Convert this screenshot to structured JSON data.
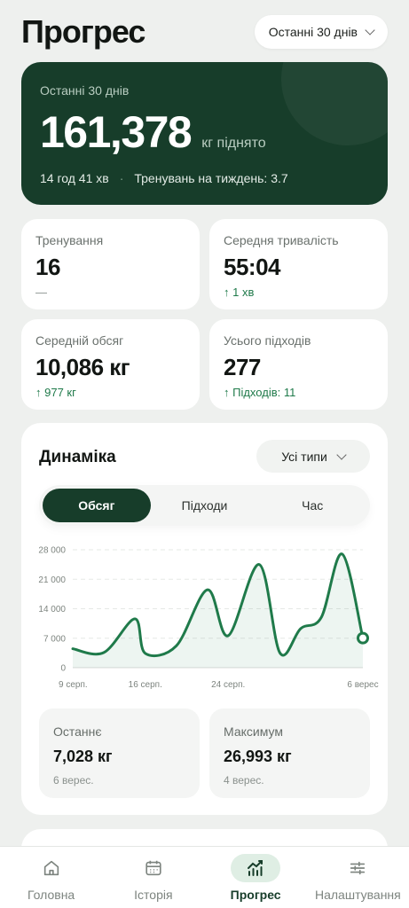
{
  "header": {
    "title": "Прогрес",
    "range": "Останні 30 днів"
  },
  "hero": {
    "period": "Останні 30 днів",
    "total": "161,378",
    "unit": "кг піднято",
    "duration": "14 год 41 хв",
    "weekly": "Тренувань на тиждень: 3.7"
  },
  "stats": [
    {
      "label": "Тренування",
      "value": "16",
      "delta": "—"
    },
    {
      "label": "Середня тривалість",
      "value": "55:04",
      "delta": "↑ 1 хв"
    },
    {
      "label": "Середній обсяг",
      "value": "10,086 кг",
      "delta": "↑ 977 кг"
    },
    {
      "label": "Усього підходів",
      "value": "277",
      "delta": "↑ Підходів: 11"
    }
  ],
  "dynamics": {
    "title": "Динаміка",
    "type_filter": "Усі типи",
    "segments": [
      "Обсяг",
      "Підходи",
      "Час"
    ],
    "last": {
      "label": "Останнє",
      "value": "7,028 кг",
      "date": "6 верес."
    },
    "max": {
      "label": "Максимум",
      "value": "26,993 кг",
      "date": "4 верес."
    }
  },
  "chart_data": {
    "type": "line",
    "x_ticks": [
      "9 серп.",
      "16 серп.",
      "24 серп.",
      "6 верес"
    ],
    "y_ticks": [
      "0",
      "7 000",
      "14 000",
      "21 000",
      "28 000"
    ],
    "ylim": [
      0,
      28000
    ],
    "x": [
      "9 серп.",
      "12 серп.",
      "15 серп.",
      "16 серп.",
      "19 серп.",
      "22 серп.",
      "24 серп.",
      "27 серп.",
      "29 серп.",
      "31 серп.",
      "2 верес.",
      "4 верес.",
      "6 верес"
    ],
    "values": [
      4500,
      3600,
      11600,
      3400,
      5200,
      18500,
      7600,
      24500,
      3500,
      9300,
      12000,
      26993,
      7028
    ],
    "grid": true,
    "color": "#1f7a4a"
  },
  "nav": {
    "items": [
      {
        "label": "Головна",
        "icon": "home-icon"
      },
      {
        "label": "Історія",
        "icon": "calendar-icon"
      },
      {
        "label": "Прогрес",
        "icon": "chart-icon"
      },
      {
        "label": "Налаштування",
        "icon": "sliders-icon"
      }
    ]
  },
  "colors": {
    "accent": "#173d2a",
    "positive": "#1f7a4a",
    "background": "#eef0ee"
  }
}
